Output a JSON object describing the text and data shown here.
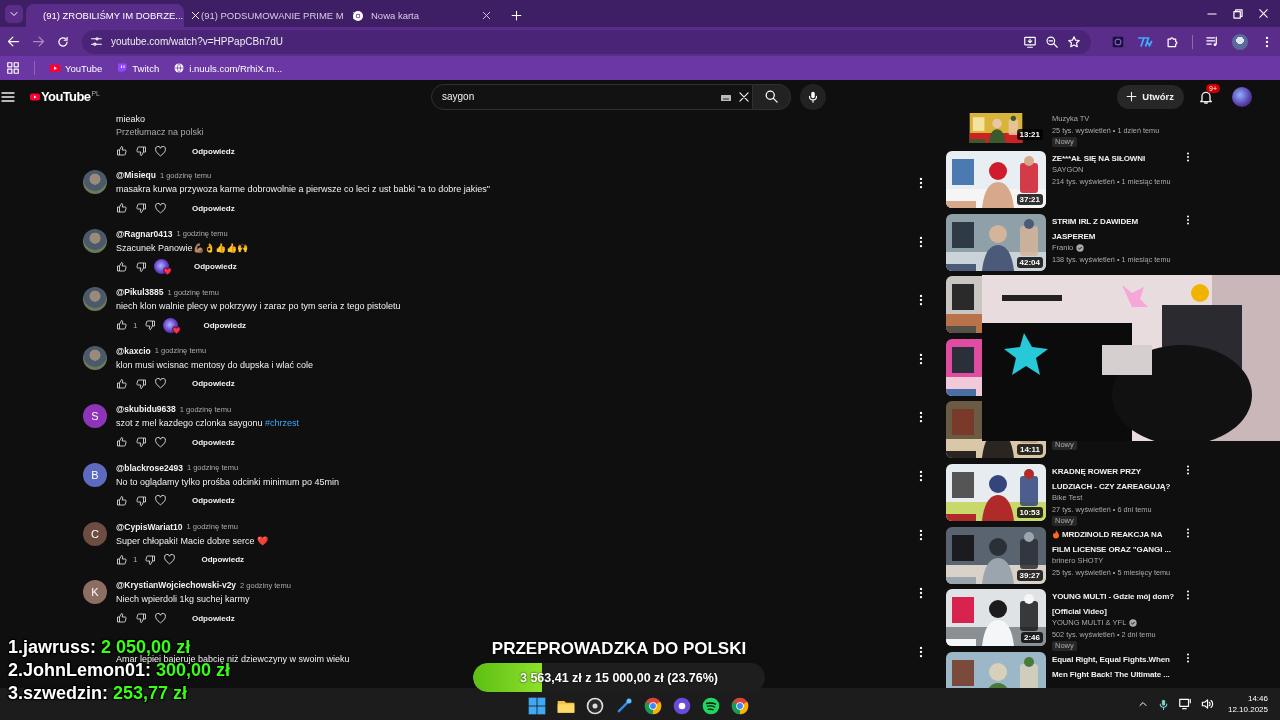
{
  "browser": {
    "tabs": [
      {
        "title": "(91) ZROBILIŚMY IM DOBRZE...",
        "kind": "youtube",
        "selected": true
      },
      {
        "title": "(91) PODSUMOWANIE PRIME M",
        "kind": "youtube",
        "selected": false
      },
      {
        "title": "Nowa karta",
        "kind": "chrome",
        "selected": false
      }
    ],
    "url": "youtube.com/watch?v=HPPapCBn7dU",
    "bookmarks": [
      {
        "label": "YouTube",
        "kind": "youtube"
      },
      {
        "label": "Twitch",
        "kind": "twitch"
      },
      {
        "label": "i.nuuls.com/RrhiX.m...",
        "kind": "globe"
      }
    ]
  },
  "header": {
    "logo": "YouTube",
    "region": "PL",
    "search": {
      "value": "saygon"
    },
    "create_label": "Utwórz",
    "notifications": "9+"
  },
  "comments": [
    {
      "kind": "top_cut",
      "text": "mieako",
      "translate": "Przetłumacz na polski",
      "hearted": false,
      "menu": false,
      "reply": "Odpowiedz"
    },
    {
      "kind": "full",
      "author": "@Misiequ",
      "time": "1 godzinę temu",
      "text": "masakra kurwa przywoza karme dobrowolnie a pierwsze co leci z ust babki \"a to dobre jakies\"",
      "hearted": false,
      "menu": true,
      "reply": "Odpowiedz"
    },
    {
      "kind": "full",
      "author": "@Ragnar0413",
      "time": "1 godzinę temu",
      "text": "Szacunek Panowie💪🏽👌👍👍🙌",
      "hearted": true,
      "menu": true,
      "reply": "Odpowiedz"
    },
    {
      "kind": "full",
      "author": "@Pikul3885",
      "time": "1 godzinę temu",
      "text": "niech klon walnie plecy w pokrzywy i zaraz po tym seria z tego pistoletu",
      "likes": "1",
      "hearted": true,
      "menu": true,
      "reply": "Odpowiedz"
    },
    {
      "kind": "full",
      "author": "@kaxcio",
      "time": "1 godzinę temu",
      "text": "klon musi wcisnac mentosy do dupska i wlać cole",
      "hearted": false,
      "menu": true,
      "reply": "Odpowiedz"
    },
    {
      "kind": "full",
      "author": "@skubidu9638",
      "time": "1 godzinę temu",
      "text": "szot z mel kazdego czlonka saygonu",
      "hashtag": "#chrzest",
      "avatar": {
        "kind": "letter",
        "letter": "S",
        "color": "#8e34b8"
      },
      "hearted": false,
      "menu": true,
      "reply": "Odpowiedz"
    },
    {
      "kind": "full",
      "author": "@blackrose2493",
      "time": "1 godzinę temu",
      "text": "No to oglądamy tylko prośba odcinki minimum po 45min",
      "avatar": {
        "kind": "letter",
        "letter": "B",
        "color": "#5c6bc0"
      },
      "hearted": false,
      "menu": true,
      "reply": "Odpowiedz"
    },
    {
      "kind": "full",
      "author": "@CypisWariat10",
      "time": "1 godzinę temu",
      "text": "Super chłopaki! Macie dobre serce ❤️",
      "avatar": {
        "kind": "letter",
        "letter": "C",
        "color": "#6d4c41"
      },
      "likes": "1",
      "hearted": false,
      "menu": true,
      "reply": "Odpowiedz"
    },
    {
      "kind": "full",
      "author": "@KrystianWojciechowski-v2y",
      "time": "2 godziny temu",
      "text": "Niech wpierdoli 1kg suchej karmy",
      "avatar": {
        "kind": "letter",
        "letter": "K",
        "color": "#8d6e63"
      },
      "hearted": false,
      "menu": true,
      "reply": "Odpowiedz"
    },
    {
      "kind": "bottom_cut",
      "text": "Amar lepiej bajeruje babcię niż dziewczyny w swoim wieku",
      "menu": true
    }
  ],
  "videos": [
    {
      "kind": "top_cut",
      "channel": "Muzyka TV",
      "meta": "25 tys. wyświetleń • 1 dzień temu",
      "badge": "Nowy",
      "duration": "13:21",
      "verified": false,
      "menu": false
    },
    {
      "kind": "full",
      "title": "ZE***AŁ SIĘ NA SIŁOWNI",
      "channel": "SAYGON",
      "meta": "214 tys. wyświetleń • 1 miesiąc temu",
      "duration": "37:21",
      "verified": false,
      "menu": true
    },
    {
      "kind": "full",
      "title": "STRIM IRL Z DAWIDEM JASPEREM",
      "channel": "Franio",
      "meta": "138 tys. wyświetleń • 1 miesiąc temu",
      "duration": "42:04",
      "verified": true,
      "menu": true
    },
    {
      "kind": "covered"
    },
    {
      "kind": "covered"
    },
    {
      "kind": "covered",
      "badge": "Nowy",
      "duration": "14:11"
    },
    {
      "kind": "full",
      "title": "KRADNĘ ROWER PRZY LUDZIACH - CZY ZAREAGUJĄ?",
      "channel": "Bike Test",
      "meta": "27 tys. wyświetleń • 6 dni temu",
      "badge": "Nowy",
      "duration": "10:53",
      "verified": false,
      "menu": true
    },
    {
      "kind": "full",
      "title_icon": true,
      "title": "MRDZINOLD REAKCJA NA FILM LICENSE ORAZ \"GANGI ...",
      "channel": "brinero SHOTY",
      "meta": "25 tys. wyświetleń • 5 miesięcy temu",
      "duration": "39:27",
      "verified": false,
      "menu": true
    },
    {
      "kind": "full",
      "title": "YOUNG MULTI - Gdzie mój dom? [Official Video]",
      "channel": "YOUNG MULTI & YFL",
      "meta": "502 tys. wyświetleń • 2 dni temu",
      "badge": "Nowy",
      "duration": "2:46",
      "verified": true,
      "menu": true
    },
    {
      "kind": "bottom_cut",
      "title": "Equal Right, Equal Fights.When Men Fight Back! The Ultimate ...",
      "verified": false,
      "menu": true
    }
  ],
  "leaderboard": [
    {
      "name": "1.jawruss:",
      "amount": "2 050,00 zł"
    },
    {
      "name": "2.JohnLemon01:",
      "amount": "300,00 zł"
    },
    {
      "name": "3.szwedzin:",
      "amount": "253,77 zł"
    }
  ],
  "goal": {
    "title": "PRZEPROWADZKA DO POLSKI",
    "text": "3 563,41 zł z 15 000,00 zł (23.76%)",
    "level": 0.2376
  },
  "taskbar": {
    "time": "14:46",
    "date": "12.10.2025"
  }
}
